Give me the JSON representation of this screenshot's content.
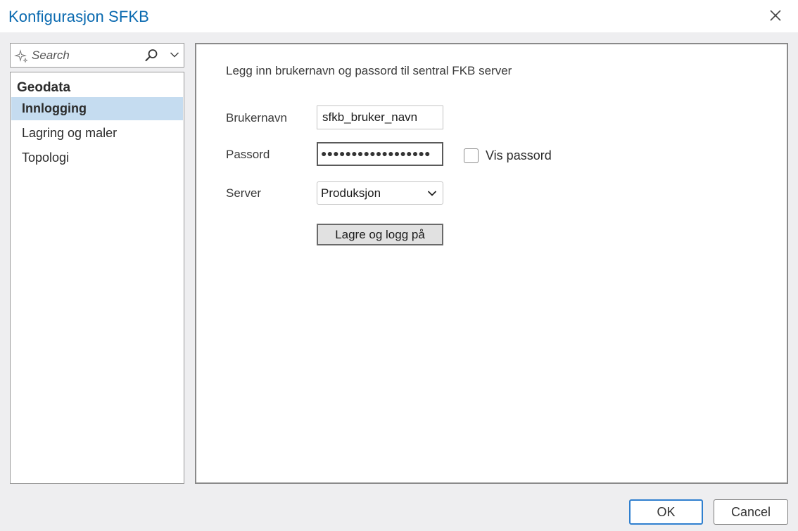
{
  "window": {
    "title": "Konfigurasjon SFKB",
    "close_icon": "close-icon"
  },
  "search": {
    "placeholder": "Search",
    "icons": [
      "sparkle-icon",
      "search-icon",
      "chevron-down-icon"
    ]
  },
  "sidebar": {
    "group": "Geodata",
    "items": [
      {
        "label": "Innlogging",
        "selected": true
      },
      {
        "label": "Lagring og maler",
        "selected": false
      },
      {
        "label": "Topologi",
        "selected": false
      }
    ]
  },
  "form": {
    "intro": "Legg inn brukernavn og passord til sentral FKB server",
    "username_label": "Brukernavn",
    "username_value": "sfkb_bruker_navn",
    "password_label": "Passord",
    "password_mask": "●●●●●●●●●●●●●●●●●●",
    "show_password_label": "Vis passord",
    "show_password_checked": false,
    "server_label": "Server",
    "server_value": "Produksjon",
    "save_login_label": "Lagre og logg på"
  },
  "footer": {
    "ok_label": "OK",
    "cancel_label": "Cancel"
  },
  "colors": {
    "title": "#0a6ab0",
    "selected_item_bg": "#c5dcf0",
    "ok_border": "#2f7fcf",
    "dialog_bg": "#eeeef0"
  }
}
